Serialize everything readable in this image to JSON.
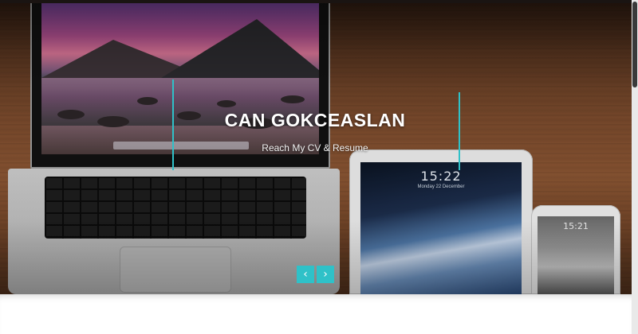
{
  "hero": {
    "title": "CAN GOKCEASLAN",
    "subtitle": "Reach My CV & Resume"
  },
  "devices": {
    "tablet_time": "15:22",
    "tablet_date": "Monday 22 December",
    "phone_time": "15:21"
  },
  "slider": {
    "prev_icon": "‹",
    "next_icon": "›"
  },
  "colors": {
    "accent": "#2fc1c8",
    "wood": "#7a4a2c"
  }
}
